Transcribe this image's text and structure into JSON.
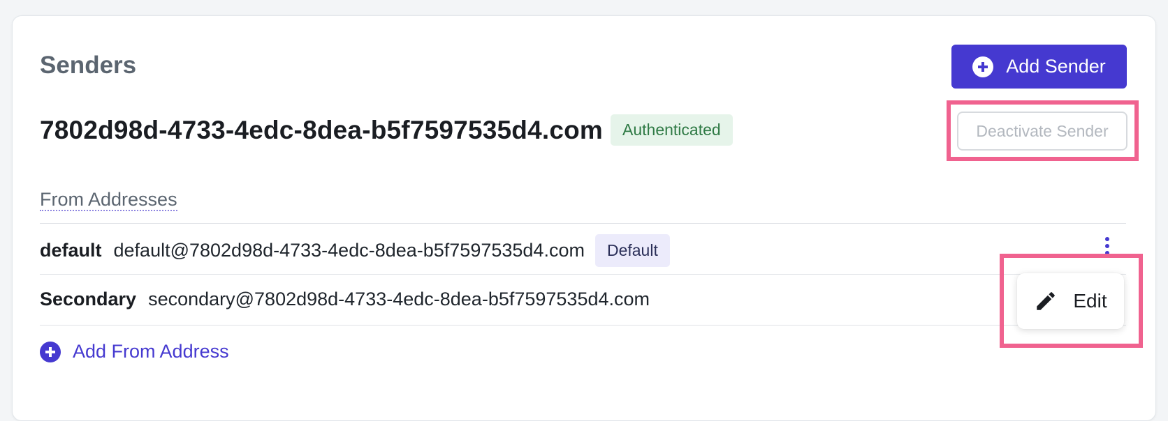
{
  "senders": {
    "title": "Senders",
    "add_sender_label": "Add Sender",
    "domain": "7802d98d-4733-4edc-8dea-b5f7597535d4.com",
    "status_badge": "Authenticated",
    "deactivate_label": "Deactivate Sender",
    "from_addresses": {
      "label": "From Addresses",
      "rows": [
        {
          "name": "default",
          "email": "default@7802d98d-4733-4edc-8dea-b5f7597535d4.com",
          "badge": "Default"
        },
        {
          "name": "Secondary",
          "email": "secondary@7802d98d-4733-4edc-8dea-b5f7597535d4.com",
          "badge": ""
        }
      ],
      "add_label": "Add From Address"
    },
    "row_menu": {
      "edit_label": "Edit"
    }
  },
  "icons": {
    "add_sender": "plus-circle-icon",
    "row_actions": "kebab-menu-icon",
    "edit": "pencil-icon",
    "add_from_address": "plus-circle-icon"
  },
  "colors": {
    "accent": "#4539d0",
    "highlight": "#f0628f",
    "authenticated_bg": "#e6f4ea",
    "authenticated_text": "#2f7a45",
    "default_badge_bg": "#ecebfb"
  }
}
